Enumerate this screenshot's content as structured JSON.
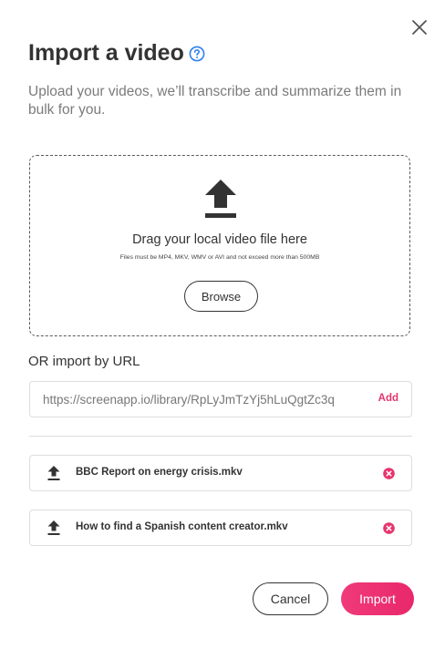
{
  "dialog": {
    "title": "Import a video",
    "subtitle": "Upload your videos, we’ll transcribe and summarize them in bulk for you.",
    "accent_color": "#e6356e",
    "help_color": "#2f80ed"
  },
  "dropzone": {
    "title": "Drag your local video file here",
    "hint": "Files must be MP4, MKV, WMV or AVI and not exceed more than 500MB",
    "browse_label": "Browse"
  },
  "url_import": {
    "label": "OR import by URL",
    "value": "https://screenapp.io/library/RpLyJmTzYj5hLuQgtZc3q",
    "add_label": "Add"
  },
  "files": [
    {
      "name": "BBC Report on energy crisis.mkv",
      "icon": "upload-icon",
      "remove_icon": "remove-icon"
    },
    {
      "name": "How to find a Spanish content creator.mkv",
      "icon": "upload-icon",
      "remove_icon": "remove-icon"
    }
  ],
  "footer": {
    "cancel_label": "Cancel",
    "import_label": "Import"
  }
}
